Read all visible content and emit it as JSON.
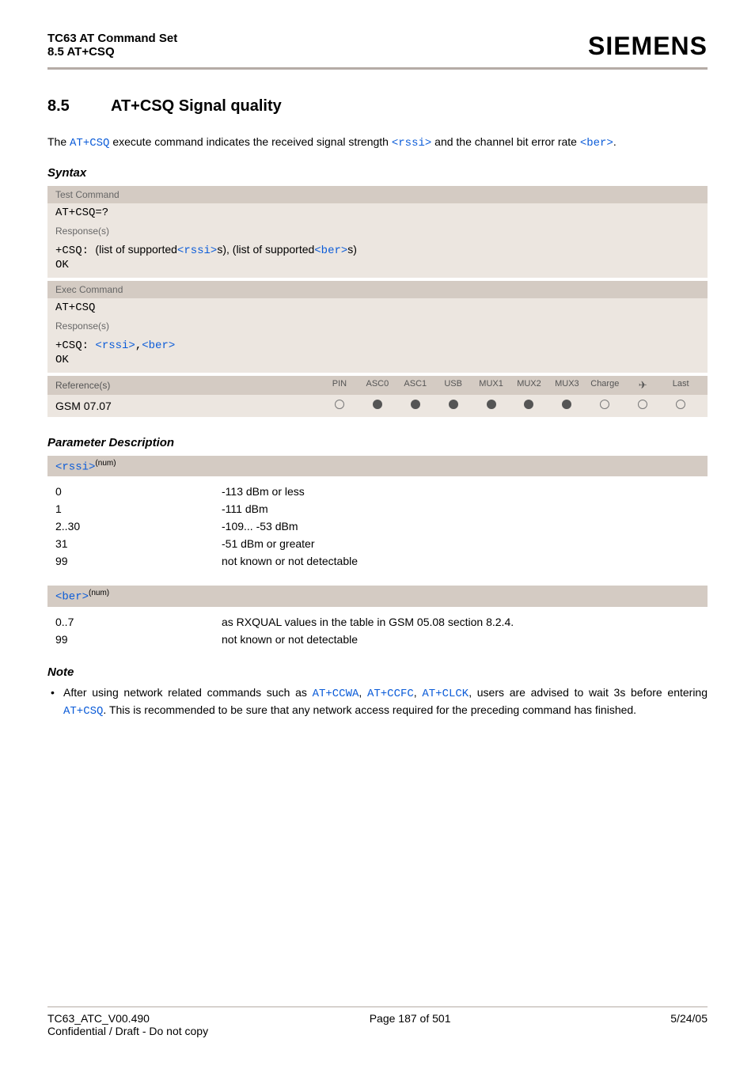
{
  "header": {
    "title": "TC63 AT Command Set",
    "subtitle": "8.5 AT+CSQ",
    "logo": "SIEMENS"
  },
  "section": {
    "number": "8.5",
    "title": "AT+CSQ   Signal quality"
  },
  "intro": {
    "prefix": "The ",
    "cmd": "AT+CSQ",
    "mid1": " execute command indicates the received signal strength ",
    "p1": "<rssi>",
    "mid2": " and the channel bit error rate ",
    "p2": "<ber>",
    "suffix": "."
  },
  "syntax_label": "Syntax",
  "test_command": {
    "label": "Test Command",
    "cmd": "AT+CSQ=?",
    "resp_label": "Response(s)",
    "resp_prefix": "+CSQ: ",
    "resp_text1": "(list of supported",
    "resp_p1": "<rssi>",
    "resp_text2": "s), (list of supported",
    "resp_p2": "<ber>",
    "resp_text3": "s)",
    "ok": "OK"
  },
  "exec_command": {
    "label": "Exec Command",
    "cmd": "AT+CSQ",
    "resp_label": "Response(s)",
    "resp_prefix": "+CSQ: ",
    "resp_p1": "<rssi>",
    "resp_comma": ",",
    "resp_p2": "<ber>",
    "ok": "OK"
  },
  "ref_table": {
    "ref_label": "Reference(s)",
    "cols": [
      "PIN",
      "ASC0",
      "ASC1",
      "USB",
      "MUX1",
      "MUX2",
      "MUX3",
      "Charge",
      "✈",
      "Last"
    ],
    "ref_value": "GSM 07.07",
    "states": [
      "open",
      "filled",
      "filled",
      "filled",
      "filled",
      "filled",
      "filled",
      "open",
      "open",
      "open"
    ]
  },
  "param_desc_label": "Parameter Description",
  "rssi": {
    "name": "<rssi>",
    "sup": "(num)",
    "rows": [
      {
        "val": "0",
        "desc": "-113 dBm or less"
      },
      {
        "val": "1",
        "desc": "-111 dBm"
      },
      {
        "val": "2..30",
        "desc": "-109... -53 dBm"
      },
      {
        "val": "31",
        "desc": "-51 dBm or greater"
      },
      {
        "val": "99",
        "desc": "not known or not detectable"
      }
    ]
  },
  "ber": {
    "name": "<ber>",
    "sup": "(num)",
    "rows": [
      {
        "val": "0..7",
        "desc": "as RXQUAL values in the table in GSM 05.08 section 8.2.4."
      },
      {
        "val": "99",
        "desc": "not known or not detectable"
      }
    ]
  },
  "note": {
    "label": "Note",
    "prefix": "After using network related commands such as ",
    "c1": "AT+CCWA",
    "s1": ", ",
    "c2": "AT+CCFC",
    "s2": ", ",
    "c3": "AT+CLCK",
    "mid": ", users are advised to wait 3s before entering ",
    "c4": "AT+CSQ",
    "suffix": ". This is recommended to be sure that any network access required for the preceding command has finished."
  },
  "footer": {
    "left": "TC63_ATC_V00.490",
    "center": "Page 187 of 501",
    "right": "5/24/05",
    "sub": "Confidential / Draft - Do not copy"
  }
}
